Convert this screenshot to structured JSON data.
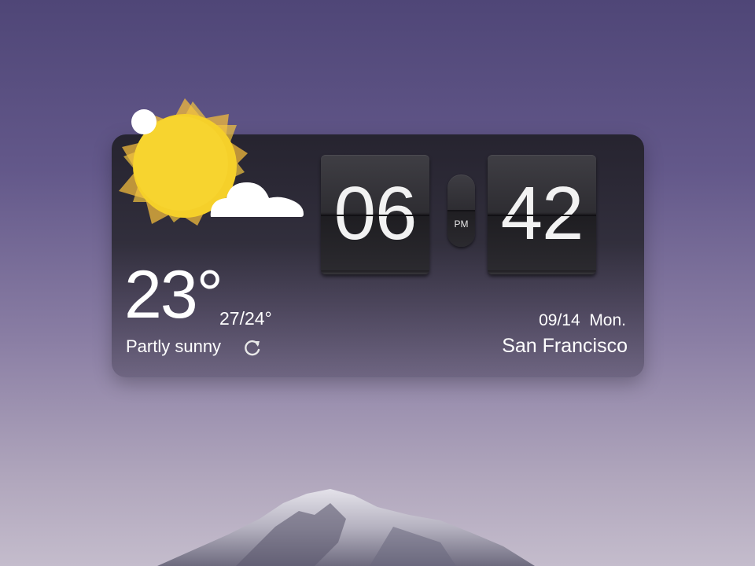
{
  "weather": {
    "temperature": "23°",
    "range": "27/24°",
    "condition": "Partly sunny",
    "icon": "partly-sunny-icon",
    "refresh_icon": "refresh-icon"
  },
  "clock": {
    "hours": "06",
    "minutes": "42",
    "period": "PM"
  },
  "date": "09/14  Mon.",
  "city": "San Francisco",
  "colors": {
    "sun": "#f5d02a",
    "sun_rays": "#f0b93c",
    "cloud": "#ffffff",
    "widget_bg": "#2c2a35"
  }
}
